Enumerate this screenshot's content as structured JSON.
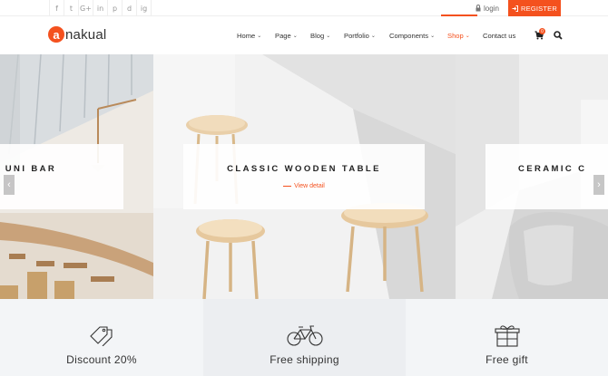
{
  "topbar": {
    "social_icons": [
      "facebook-icon",
      "twitter-icon",
      "google-plus-icon",
      "linkedin-icon",
      "pinterest-icon",
      "dribbble-icon",
      "instagram-icon"
    ],
    "social_glyphs": [
      "f",
      "t",
      "G+",
      "in",
      "p",
      "d",
      "ig"
    ],
    "login_label": "login",
    "register_label": "REGISTER"
  },
  "header": {
    "logo_mark": "a",
    "logo_text": "nakual",
    "nav": [
      {
        "label": "Home",
        "has_dropdown": true
      },
      {
        "label": "Page",
        "has_dropdown": true
      },
      {
        "label": "Blog",
        "has_dropdown": true
      },
      {
        "label": "Portfolio",
        "has_dropdown": true
      },
      {
        "label": "Components",
        "has_dropdown": true
      },
      {
        "label": "Shop",
        "has_dropdown": true,
        "active": true
      },
      {
        "label": "Contact us",
        "has_dropdown": false
      }
    ],
    "cart_count": "0"
  },
  "slider": {
    "slides": [
      {
        "title": "UNI BAR"
      },
      {
        "title": "CLASSIC WOODEN TABLE",
        "link": "View detail"
      },
      {
        "title": "CERAMIC C"
      }
    ],
    "prev_icon": "chevron-left-icon",
    "next_icon": "chevron-right-icon"
  },
  "features": [
    {
      "icon": "tag-icon",
      "label": "Discount 20%"
    },
    {
      "icon": "bicycle-icon",
      "label": "Free shipping"
    },
    {
      "icon": "gift-icon",
      "label": "Free gift"
    }
  ],
  "colors": {
    "accent": "#f4511e",
    "text": "#333333",
    "feature_bg": "#f3f5f7"
  }
}
